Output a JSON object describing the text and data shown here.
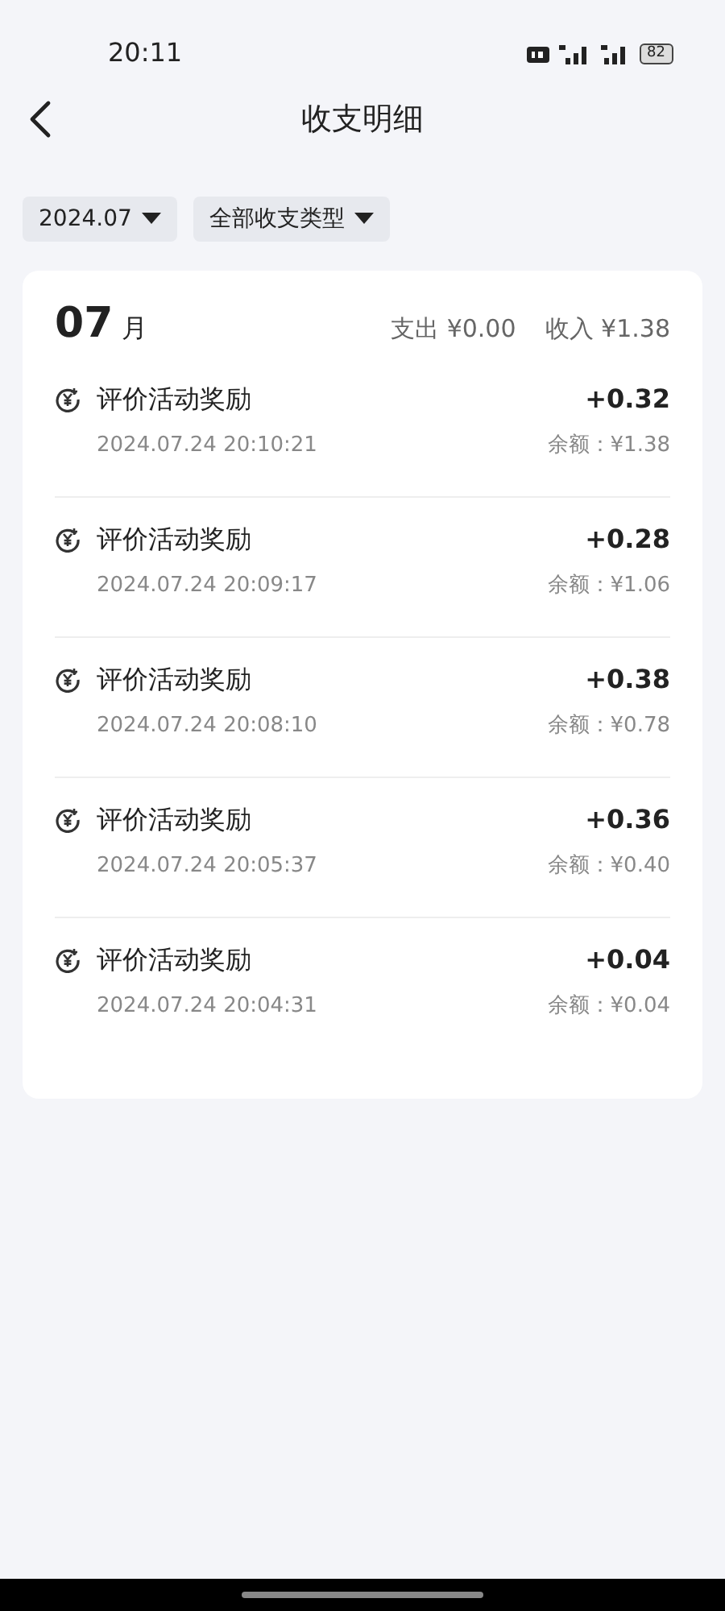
{
  "status_bar": {
    "time": "20:11",
    "battery": "82"
  },
  "header": {
    "title": "收支明细"
  },
  "filters": [
    {
      "label": "2024.07"
    },
    {
      "label": "全部收支类型"
    }
  ],
  "month": {
    "number": "07",
    "unit": "月",
    "expense": "支出 ¥0.00",
    "income": "收入 ¥1.38"
  },
  "transactions": [
    {
      "title": "评价活动奖励",
      "time": "2024.07.24 20:10:21",
      "amount": "+0.32",
      "balance": "余额：¥1.38"
    },
    {
      "title": "评价活动奖励",
      "time": "2024.07.24 20:09:17",
      "amount": "+0.28",
      "balance": "余额：¥1.06"
    },
    {
      "title": "评价活动奖励",
      "time": "2024.07.24 20:08:10",
      "amount": "+0.38",
      "balance": "余额：¥0.78"
    },
    {
      "title": "评价活动奖励",
      "time": "2024.07.24 20:05:37",
      "amount": "+0.36",
      "balance": "余额：¥0.40"
    },
    {
      "title": "评价活动奖励",
      "time": "2024.07.24 20:04:31",
      "amount": "+0.04",
      "balance": "余额：¥0.04"
    }
  ]
}
